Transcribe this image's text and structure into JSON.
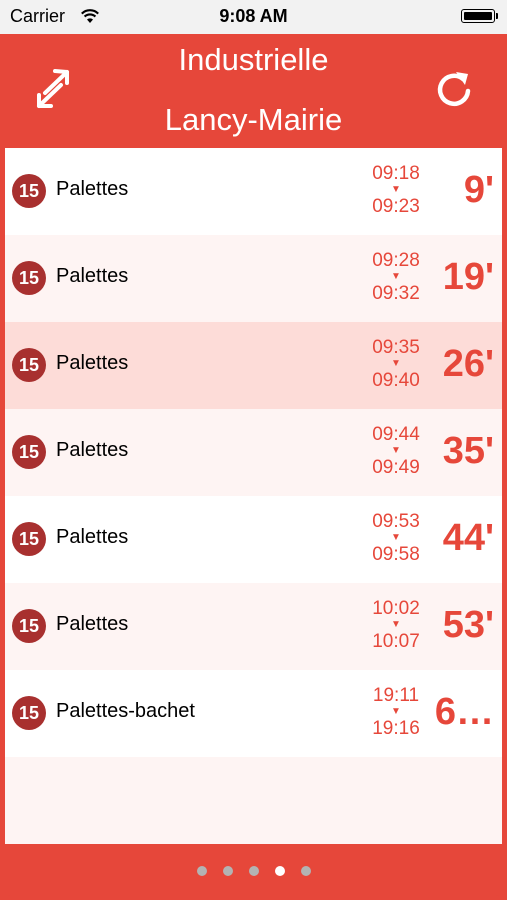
{
  "status_bar": {
    "carrier": "Carrier",
    "time": "9:08 AM"
  },
  "header": {
    "from": "Industrielle",
    "to": "Lancy-Mairie"
  },
  "connections": [
    {
      "line": "15",
      "destination": "Palettes",
      "departure": "09:18",
      "arrival": "09:23",
      "minutes": "9'"
    },
    {
      "line": "15",
      "destination": "Palettes",
      "departure": "09:28",
      "arrival": "09:32",
      "minutes": "19'"
    },
    {
      "line": "15",
      "destination": "Palettes",
      "departure": "09:35",
      "arrival": "09:40",
      "minutes": "26'"
    },
    {
      "line": "15",
      "destination": "Palettes",
      "departure": "09:44",
      "arrival": "09:49",
      "minutes": "35'"
    },
    {
      "line": "15",
      "destination": "Palettes",
      "departure": "09:53",
      "arrival": "09:58",
      "minutes": "44'"
    },
    {
      "line": "15",
      "destination": "Palettes",
      "departure": "10:02",
      "arrival": "10:07",
      "minutes": "53'"
    },
    {
      "line": "15",
      "destination": "Palettes-bachet",
      "departure": "19:11",
      "arrival": "19:16",
      "minutes": "6…"
    }
  ],
  "arrow_glyph": "▼",
  "colors": {
    "accent": "#e6473a",
    "badge": "#a8302f",
    "highlight": "#fddcd8"
  },
  "pager": {
    "count": 5,
    "active_index": 3
  }
}
